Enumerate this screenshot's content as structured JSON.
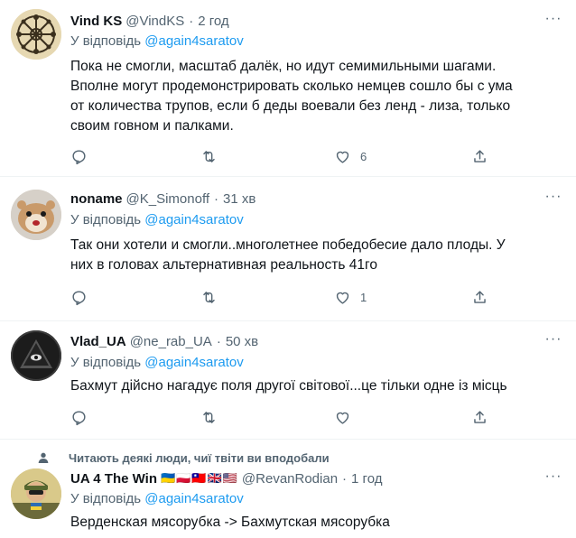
{
  "reply_prefix": "У відповідь",
  "tweets": [
    {
      "name": "Vind KS",
      "handle": "@VindKS",
      "time": "2 год",
      "reply_to": "@again4saratov",
      "lines": [
        "Пока не смогли, масштаб далёк, но идут семимильными шагами.",
        "Вполне могут продемонстрировать сколько немцев сошло бы с ума",
        "от количества трупов, если б деды воевали без ленд - лиза, только",
        "своим говном и палками."
      ],
      "like_count": "6"
    },
    {
      "name": "noname",
      "handle": "@K_Simonoff",
      "time": "31 хв",
      "reply_to": "@again4saratov",
      "lines": [
        "Так они хотели и смогли..многолетнее победобесие дало плоды. У",
        "них в головах альтернативная реальность 41го"
      ],
      "like_count": "1"
    },
    {
      "name": "Vlad_UA",
      "handle": "@ne_rab_UA",
      "time": "50 хв",
      "reply_to": "@again4saratov",
      "lines": [
        "Бахмут дійсно нагадує поля другої світової...це тільки одне із місць"
      ],
      "like_count": ""
    },
    {
      "name": "UA 4 The Win",
      "flags": "🇺🇦🇵🇱🇹🇼🇬🇧🇺🇸",
      "handle": "@RevanRodian",
      "time": "1 год",
      "reply_to": "@again4saratov",
      "lines": [
        "Верденская мясорубка -> Бахмутская мясорубка"
      ],
      "like_count": ""
    }
  ],
  "social_context": "Читають деякі люди, чиї твіти ви вподобали",
  "colors": {
    "text": "#0f1419",
    "secondary": "#536471",
    "accent": "#1d9bf0",
    "divider": "#eff3f4"
  },
  "icons": {
    "reply": "reply-icon",
    "retweet": "retweet-icon",
    "like": "like-icon",
    "share": "share-icon",
    "more": "more-icon",
    "person": "person-icon"
  }
}
